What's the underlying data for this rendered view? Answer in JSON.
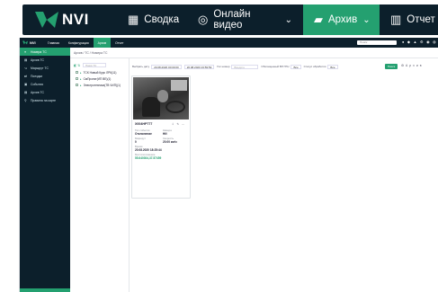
{
  "brand": {
    "name": "NVI",
    "accent": "#24a070",
    "dark": "#0c1f2b"
  },
  "zoom_nav": {
    "items": [
      {
        "label": "Сводка",
        "icon": "grid-icon"
      },
      {
        "label": "Онлайн видео",
        "icon": "camera-icon"
      },
      {
        "label": "Архив",
        "icon": "folder-icon"
      },
      {
        "label": "Отчет",
        "icon": "bar-chart-icon"
      }
    ]
  },
  "topbar": {
    "items": [
      "Главная",
      "Конфигурация",
      "Архив",
      "Отчет"
    ],
    "search_placeholder": "Поиск"
  },
  "sidebar": {
    "items": [
      "Номера ТС",
      "Архив ТС",
      "Маршрут ТС",
      "Поездки",
      "События",
      "Архив ТС",
      "Правила на карте"
    ]
  },
  "breadcrumb": "Архив / ТС / Номера ТС",
  "tree": {
    "search_placeholder": "Поиск ТС",
    "items": [
      "ТСК Новый Курс ЛРК(11)",
      "СмПроект(ИП ВЕ)(1)",
      "Электротехника(ТВ ЧИП)(1)"
    ]
  },
  "filters": {
    "period_label": "Выбрать дату",
    "from": "20.08.2020 00:00:00",
    "to": "20.08.2020 23:59:59",
    "plate_label": "Гос номер",
    "plate_placeholder": "Введите",
    "show_label": "Обогащенный ВЛ ГРН",
    "show_value": "Все",
    "status_label": "Статус обработки",
    "status_value": "Все",
    "search_button": "Поиск",
    "extra": "Архив"
  },
  "card": {
    "plate": "Х004НР777",
    "rows": [
      {
        "label": "Тип события",
        "value": "Отклонение"
      },
      {
        "label": "Камера",
        "value": "НИ"
      },
      {
        "label": "Маршрут",
        "value": "0"
      },
      {
        "label": "Скорость",
        "value": "20.00 км/ч"
      },
      {
        "label": "Время",
        "value": "20.08.2020 18:25:44"
      },
      {
        "label": "Местоположение",
        "value": "55.640304,37.57459"
      }
    ]
  }
}
